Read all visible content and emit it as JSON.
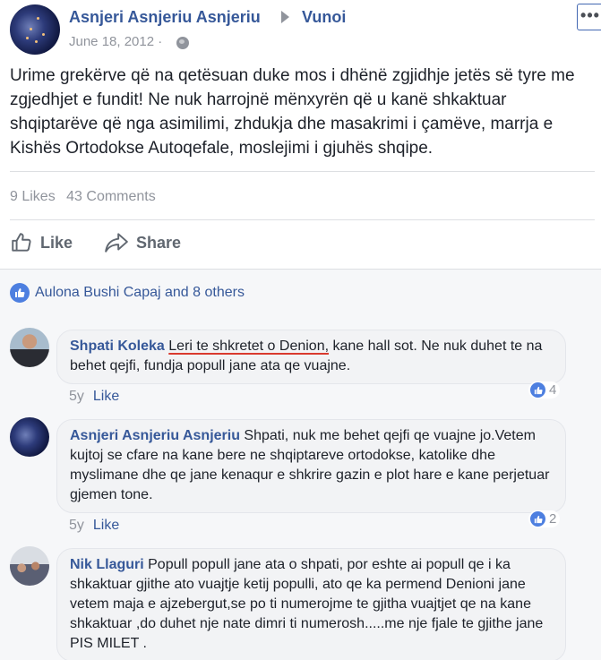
{
  "post": {
    "author": "Asnjeri Asnjeriu Asnjeriu",
    "target": "Vunoi",
    "date": "June 18, 2012 ·",
    "text": "Urime grekërve që na qetësuan duke mos i dhënë zgjidhje jetës së tyre me zgjedhjet e fundit! Ne nuk harrojnë mënxyrën që u kanë shkaktuar shqiptarëve që nga asimilimi, zhdukja dhe masakrimi i çamëve, marrja e Kishës Ortodokse Autoqefale, moslejimi i gjuhës shqipe.",
    "more_label": "•••"
  },
  "stats": {
    "likes": "9 Likes",
    "comments": "43 Comments"
  },
  "actions": {
    "like": "Like",
    "share": "Share"
  },
  "reactions": {
    "text": "Aulona Bushi Capaj and 8 others"
  },
  "comments": [
    {
      "name": "Shpati Koleka",
      "highlight": "Leri te shkretet o Denion,",
      "text": " kane hall sot. Ne nuk duhet te na behet qejfi, fundja popull jane ata qe vuajne.",
      "age": "5y",
      "like": "Like",
      "reactions": "4"
    },
    {
      "name": "Asnjeri Asnjeriu Asnjeriu",
      "text": " Shpati, nuk me behet qejfi qe vuajne jo.Vetem kujtoj se cfare na kane bere ne shqiptareve ortodokse, katolike dhe myslimane dhe qe jane kenaqur e shkrire gazin e plot hare e kane perjetuar gjemen tone.",
      "age": "5y",
      "like": "Like",
      "reactions": "2"
    },
    {
      "name": "Nik Llaguri",
      "text": " Popull popull jane ata o shpati, por eshte ai popull qe i ka shkaktuar gjithe ato vuajtje ketij populli, ato qe ka permend Denioni jane vetem maja e ajzebergut,se po ti numerojme te gjitha vuajtjet qe na kane shkaktuar ,do duhet nje nate dimri ti numerosh.....me nje fjale te gjithe jane PIS MILET ."
    }
  ],
  "icons": [
    "globe-icon",
    "thumbs-up-icon",
    "share-arrow-icon",
    "like-badge-icon",
    "more-options-icon"
  ],
  "colors": {
    "link": "#365899",
    "meta": "#90949c",
    "like_blue": "#4d7fe0",
    "underline_red": "#d93a2e"
  }
}
